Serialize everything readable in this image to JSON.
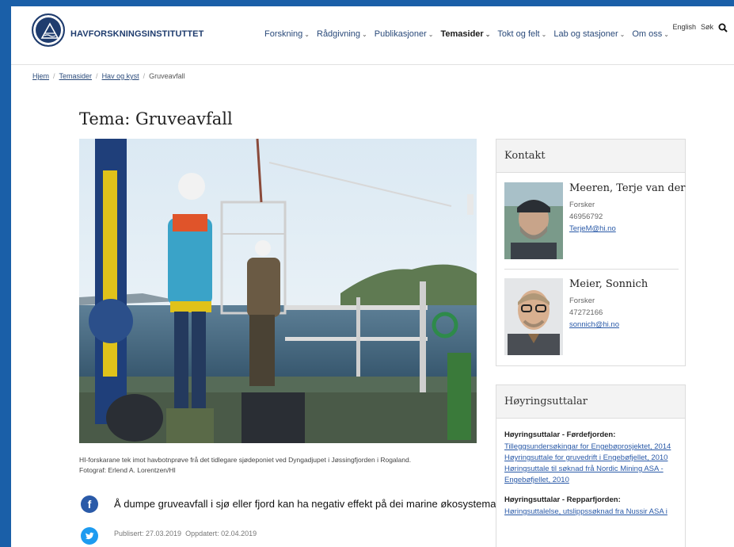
{
  "header": {
    "brand": "HAVFORSKNINGSINSTITUTTET",
    "nav": [
      {
        "label": "Forskning",
        "active": false
      },
      {
        "label": "Rådgivning",
        "active": false
      },
      {
        "label": "Publikasjoner",
        "active": false
      },
      {
        "label": "Temasider",
        "active": true
      },
      {
        "label": "Tokt og felt",
        "active": false
      },
      {
        "label": "Lab og stasjoner",
        "active": false
      },
      {
        "label": "Om oss",
        "active": false
      }
    ],
    "english": "English",
    "search": "Søk"
  },
  "breadcrumb": {
    "items": [
      "Hjem",
      "Temasider",
      "Hav og kyst"
    ],
    "current": "Gruveavfall"
  },
  "page": {
    "title": "Tema: Gruveavfall",
    "caption_line1": "HI-forskarane tek imot havbotnprøve frå det tidlegare sjødeponiet ved Dyngadjupet i Jøssingfjorden i Rogaland.",
    "caption_line2": "Fotograf: Erlend A. Lorentzen/HI",
    "lead": "Å dumpe gruveavfall i sjø eller fjord kan ha negativ effekt på dei marine økosystema.",
    "published": "Publisert: 27.03.2019",
    "updated": "Oppdatert: 02.04.2019"
  },
  "contact_box": {
    "title": "Kontakt",
    "contacts": [
      {
        "name": "Meeren, Terje van der",
        "role": "Forsker",
        "phone": "46956792",
        "email": "TerjeM@hi.no"
      },
      {
        "name": "Meier, Sonnich",
        "role": "Forsker",
        "phone": "47272166",
        "email": "sonnich@hi.no"
      }
    ]
  },
  "hearing_box": {
    "title": "Høyringsuttalar",
    "groups": [
      {
        "title": "Høyringsuttalar - Førdefjorden:",
        "links": [
          "Tilleggsundersøkingar for Engebøprosjektet, 2014",
          "Høyringsuttale for gruvedrift i Engebøfjellet, 2010",
          "Høringsuttale til søknad frå Nordic Mining ASA -",
          "Engebøfjellet, 2010"
        ]
      },
      {
        "title": "Høyringsuttalar - Repparfjorden:",
        "links": [
          "Høringsuttalelse, utslippssøknad fra Nussir ASA i"
        ]
      }
    ]
  },
  "colors": {
    "brand": "#1f3c6e",
    "link": "#2a5aa8",
    "frame": "#1a5fa8"
  }
}
